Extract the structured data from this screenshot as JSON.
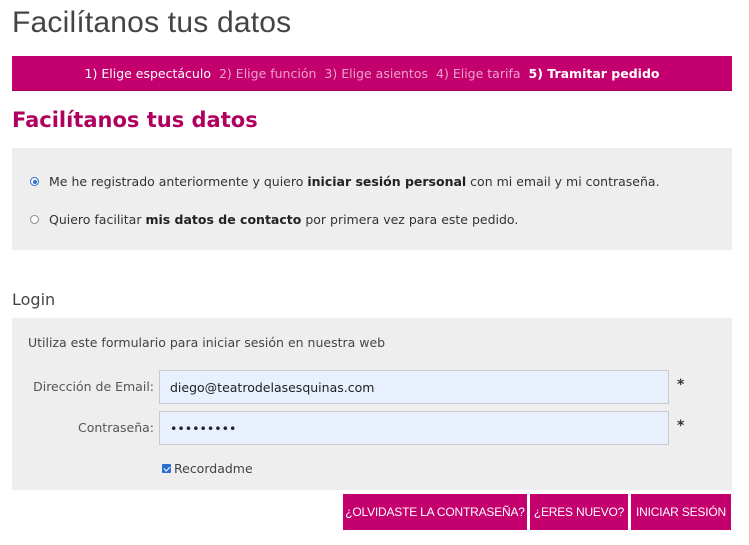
{
  "page": {
    "title": "Facilítanos tus datos"
  },
  "steps": [
    {
      "num": "1)",
      "label": "Elige espectáculo",
      "state": "done"
    },
    {
      "num": "2)",
      "label": "Elige función",
      "state": "todo"
    },
    {
      "num": "3)",
      "label": "Elige asientos",
      "state": "todo"
    },
    {
      "num": "4)",
      "label": "Elige tarifa",
      "state": "todo"
    },
    {
      "num": "5)",
      "label": "Tramitar pedido",
      "state": "active"
    }
  ],
  "section": {
    "title": "Facilítanos tus datos"
  },
  "options": [
    {
      "pre": "Me he registrado anteriormente y quiero ",
      "bold": "iniciar sesión personal",
      "post": " con mi email y mi contraseña.",
      "checked": true
    },
    {
      "pre": "Quiero facilitar ",
      "bold": "mis datos de contacto",
      "post": " por primera vez para este pedido.",
      "checked": false
    }
  ],
  "login": {
    "title": "Login",
    "intro": "Utiliza este formulario para iniciar sesión en nuestra web",
    "email_label": "Dirección de Email:",
    "email_value": "diego@teatrodelasesquinas.com",
    "password_label": "Contraseña:",
    "password_value": "diegoteat",
    "required_mark": "*",
    "remember_label": "Recordadme",
    "remember_checked": true
  },
  "buttons": {
    "forgot": "¿OLVIDASTE LA CONTRASEÑA?",
    "new": "¿ERES NUEVO?",
    "login": "INICIAR SESIÓN"
  },
  "colors": {
    "brand": "#c4006e",
    "panel": "#eeeeee",
    "input_bg": "#e8f0fe"
  }
}
